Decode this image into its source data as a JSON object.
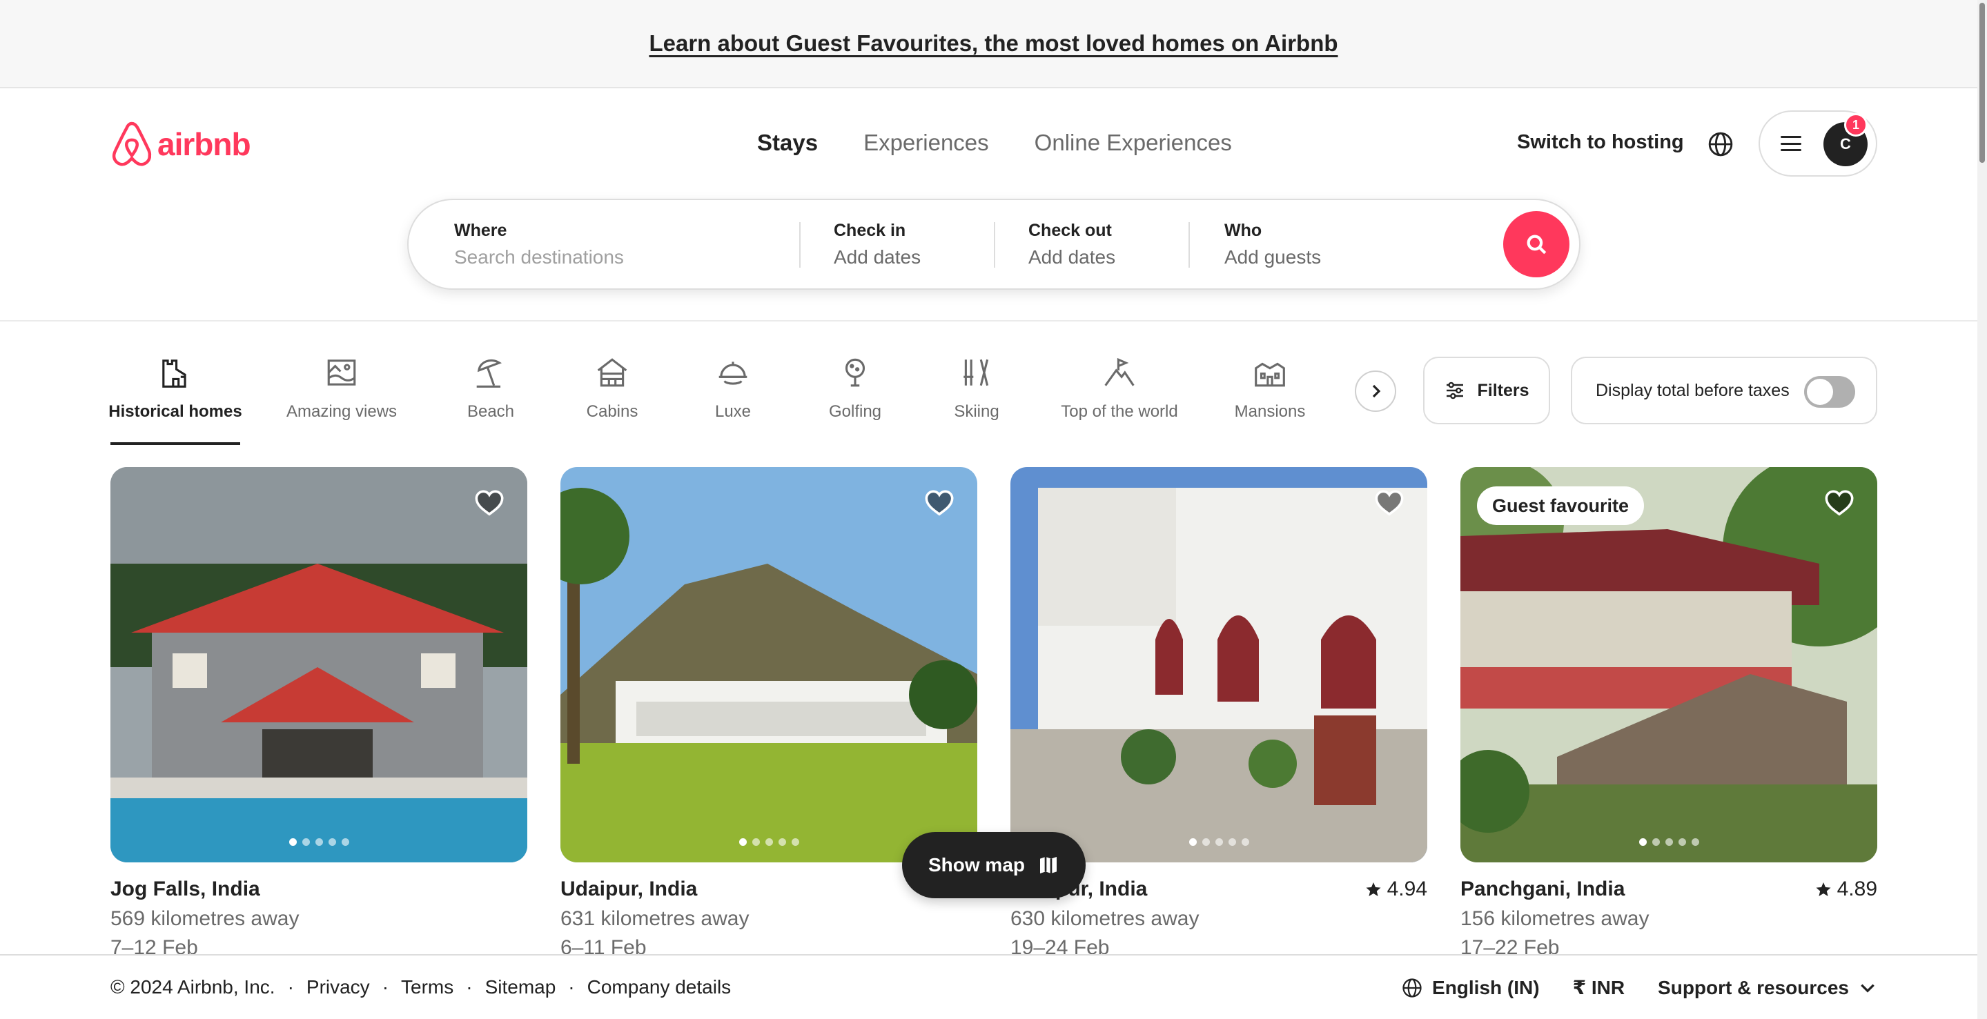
{
  "banner": {
    "text": "Learn about Guest Favourites, the most loved homes on Airbnb"
  },
  "brand": {
    "name": "airbnb",
    "color": "#ff385c"
  },
  "nav": {
    "stays": "Stays",
    "experiences": "Experiences",
    "online_experiences": "Online Experiences"
  },
  "header": {
    "host_link": "Switch to hosting",
    "avatar_initial": "C",
    "notification_count": "1"
  },
  "search": {
    "where_label": "Where",
    "where_placeholder": "Search destinations",
    "checkin_label": "Check in",
    "checkin_value": "Add dates",
    "checkout_label": "Check out",
    "checkout_value": "Add dates",
    "who_label": "Who",
    "who_value": "Add guests"
  },
  "categories": [
    {
      "label": "Historical homes",
      "icon": "historical-homes-icon",
      "active": true
    },
    {
      "label": "Amazing views",
      "icon": "amazing-views-icon"
    },
    {
      "label": "Beach",
      "icon": "beach-icon"
    },
    {
      "label": "Cabins",
      "icon": "cabins-icon"
    },
    {
      "label": "Luxe",
      "icon": "luxe-icon"
    },
    {
      "label": "Golfing",
      "icon": "golfing-icon"
    },
    {
      "label": "Skiing",
      "icon": "skiing-icon"
    },
    {
      "label": "Top of the world",
      "icon": "top-of-the-world-icon"
    },
    {
      "label": "Mansions",
      "icon": "mansions-icon"
    }
  ],
  "filters": {
    "label": "Filters",
    "taxes_label": "Display total before taxes",
    "taxes_on": false
  },
  "listings": [
    {
      "title": "Jog Falls, India",
      "rating": "",
      "distance": "569 kilometres away",
      "dates": "7–12 Feb",
      "badge": ""
    },
    {
      "title": "Udaipur, India",
      "rating": "",
      "distance": "631 kilometres away",
      "dates": "6–11 Feb",
      "badge": ""
    },
    {
      "title": "Udaipur, India",
      "rating": "4.94",
      "distance": "630 kilometres away",
      "dates": "19–24 Feb",
      "badge": ""
    },
    {
      "title": "Panchgani, India",
      "rating": "4.89",
      "distance": "156 kilometres away",
      "dates": "17–22 Feb",
      "badge": "Guest favourite"
    }
  ],
  "show_map": {
    "label": "Show map"
  },
  "footer": {
    "copyright": "© 2024 Airbnb, Inc.",
    "links": [
      "Privacy",
      "Terms",
      "Sitemap",
      "Company details"
    ],
    "language": "English (IN)",
    "currency": "₹ INR",
    "support": "Support & resources"
  }
}
